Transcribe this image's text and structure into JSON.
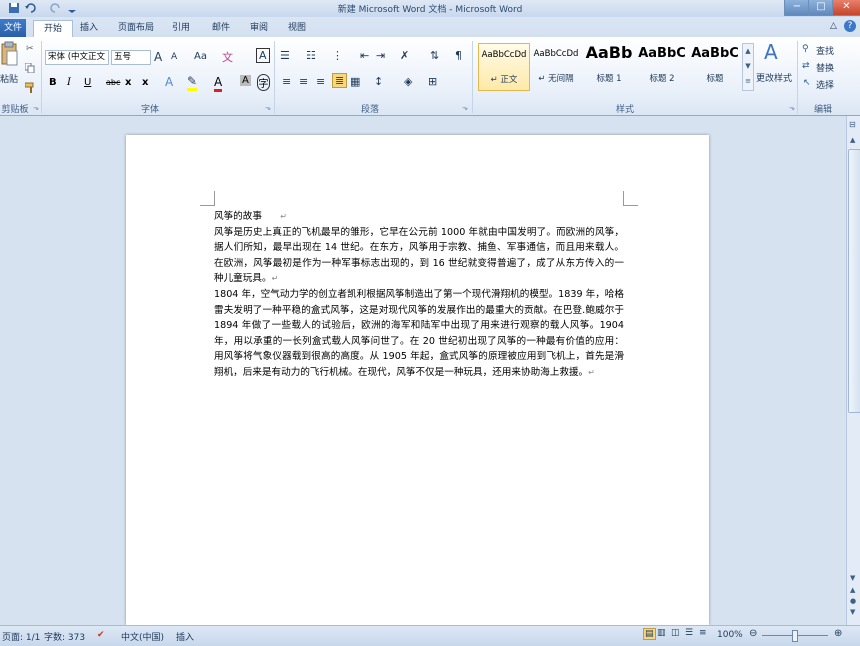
{
  "window": {
    "title": "新建 Microsoft Word 文档 - Microsoft Word",
    "controls": [
      "−",
      "□",
      "✕"
    ]
  },
  "tabs": [
    {
      "label": "文件"
    },
    {
      "label": "开始"
    },
    {
      "label": "插入"
    },
    {
      "label": "页面布局"
    },
    {
      "label": "引用"
    },
    {
      "label": "邮件"
    },
    {
      "label": "审阅"
    },
    {
      "label": "视图"
    }
  ],
  "ribbon": {
    "clipboard": {
      "paste_label": "粘贴",
      "group_label": "剪贴板"
    },
    "font": {
      "font_name": "宋体 (中文正文",
      "font_size": "五号",
      "grow": "A",
      "shrink": "A",
      "change_case": "Aa",
      "bold": "B",
      "italic": "I",
      "underline": "U",
      "strike": "abc",
      "subscript": "x",
      "superscript": "x",
      "font_color_letter": "A",
      "group_label": "字体"
    },
    "paragraph": {
      "group_label": "段落"
    },
    "styles": {
      "group_label": "样式",
      "items": [
        {
          "sample": "AaBbCcDd",
          "name": "↵ 正文"
        },
        {
          "sample": "AaBbCcDd",
          "name": "↵ 无间隔"
        },
        {
          "sample": "AaBb",
          "name": "标题 1"
        },
        {
          "sample": "AaBbC",
          "name": "标题 2"
        },
        {
          "sample": "AaBbC",
          "name": "标题"
        }
      ],
      "change_styles": "更改样式"
    },
    "editing": {
      "group_label": "编辑",
      "find": "查找",
      "replace": "替换",
      "select": "选择"
    }
  },
  "document": {
    "title_line": "风筝的故事",
    "paragraphs": [
      "风筝是历史上真正的飞机最早的雏形，它早在公元前 1000 年就由中国发明了。而欧洲的风筝，据人们所知，最早出现在 14 世纪。在东方，风筝用于宗教、捕鱼、军事通信，而且用来载人。在欧洲，风筝最初是作为一种军事标志出现的，到 16 世纪就变得普遍了，成了从东方传入的一种儿童玩具。",
      "1804 年，空气动力学的创立者凯利根据风筝制造出了第一个现代滑翔机的模型。1839 年，哈格雷夫发明了一种平稳的盒式风筝，这是对现代风筝的发展作出的最重大的贡献。在巴登.鲍威尔于 1894 年做了一些载人的试验后，欧洲的海军和陆军中出现了用来进行观察的载人风筝。1904 年，用以承重的一长列盒式载人风筝问世了。在 20 世纪初出现了风筝的一种最有价值的应用：用风筝将气象仪器载到很高的高度。从 1905 年起，盒式风筝的原理被应用到飞机上，首先是滑翔机，后来是有动力的飞行机械。在现代，风筝不仅是一种玩具，还用来协助海上救援。"
    ]
  },
  "statusbar": {
    "page": "页面: 1/1",
    "words": "字数: 373",
    "language": "中文(中国)",
    "mode": "插入",
    "zoom": "100%"
  }
}
